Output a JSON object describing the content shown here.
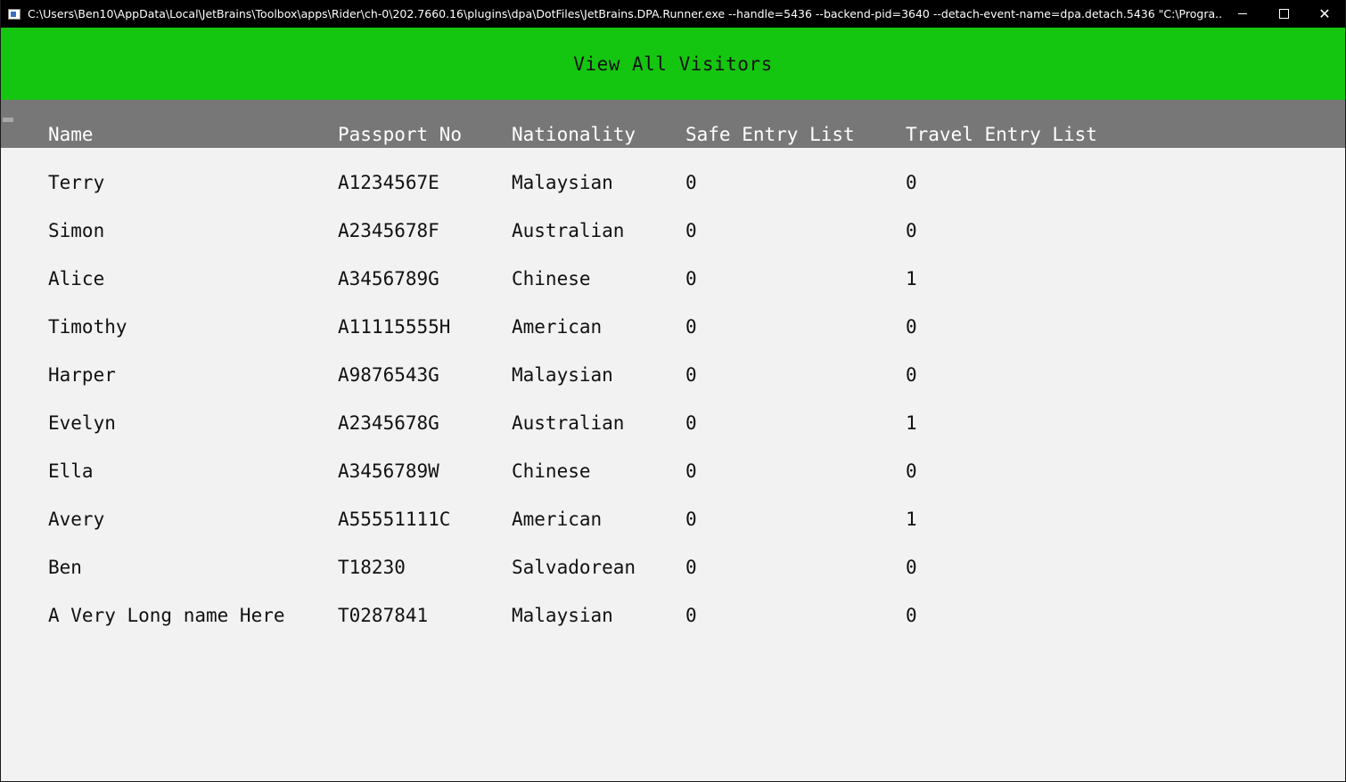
{
  "window": {
    "title": "C:\\Users\\Ben10\\AppData\\Local\\JetBrains\\Toolbox\\apps\\Rider\\ch-0\\202.7660.16\\plugins\\dpa\\DotFiles\\JetBrains.DPA.Runner.exe --handle=5436 --backend-pid=3640 --detach-event-name=dpa.detach.5436 \"C:\\Progra...",
    "controls": {
      "minimize": "",
      "maximize": "",
      "close": "✕"
    }
  },
  "header": {
    "title": "View All Visitors"
  },
  "table": {
    "columns": [
      "Name",
      "Passport No",
      "Nationality",
      "Safe Entry List",
      "Travel Entry List"
    ],
    "rows": [
      [
        "Terry",
        "A1234567E",
        "Malaysian",
        "0",
        "0"
      ],
      [
        "Simon",
        "A2345678F",
        "Australian",
        "0",
        "0"
      ],
      [
        "Alice",
        "A3456789G",
        "Chinese",
        "0",
        "1"
      ],
      [
        "Timothy",
        "A11115555H",
        "American",
        "0",
        "0"
      ],
      [
        "Harper",
        "A9876543G",
        "Malaysian",
        "0",
        "0"
      ],
      [
        "Evelyn",
        "A2345678G",
        "Australian",
        "0",
        "1"
      ],
      [
        "Ella",
        "A3456789W",
        "Chinese",
        "0",
        "0"
      ],
      [
        "Avery",
        "A55551111C",
        "American",
        "0",
        "1"
      ],
      [
        "Ben",
        "T18230",
        "Salvadorean",
        "0",
        "0"
      ],
      [
        "A Very Long name Here",
        "T0287841",
        "Malaysian",
        "0",
        "0"
      ]
    ]
  },
  "colors": {
    "header_bg": "#14c60f",
    "column_header_bg": "#777777",
    "body_bg": "#f2f2f2",
    "titlebar_bg": "#000000"
  }
}
